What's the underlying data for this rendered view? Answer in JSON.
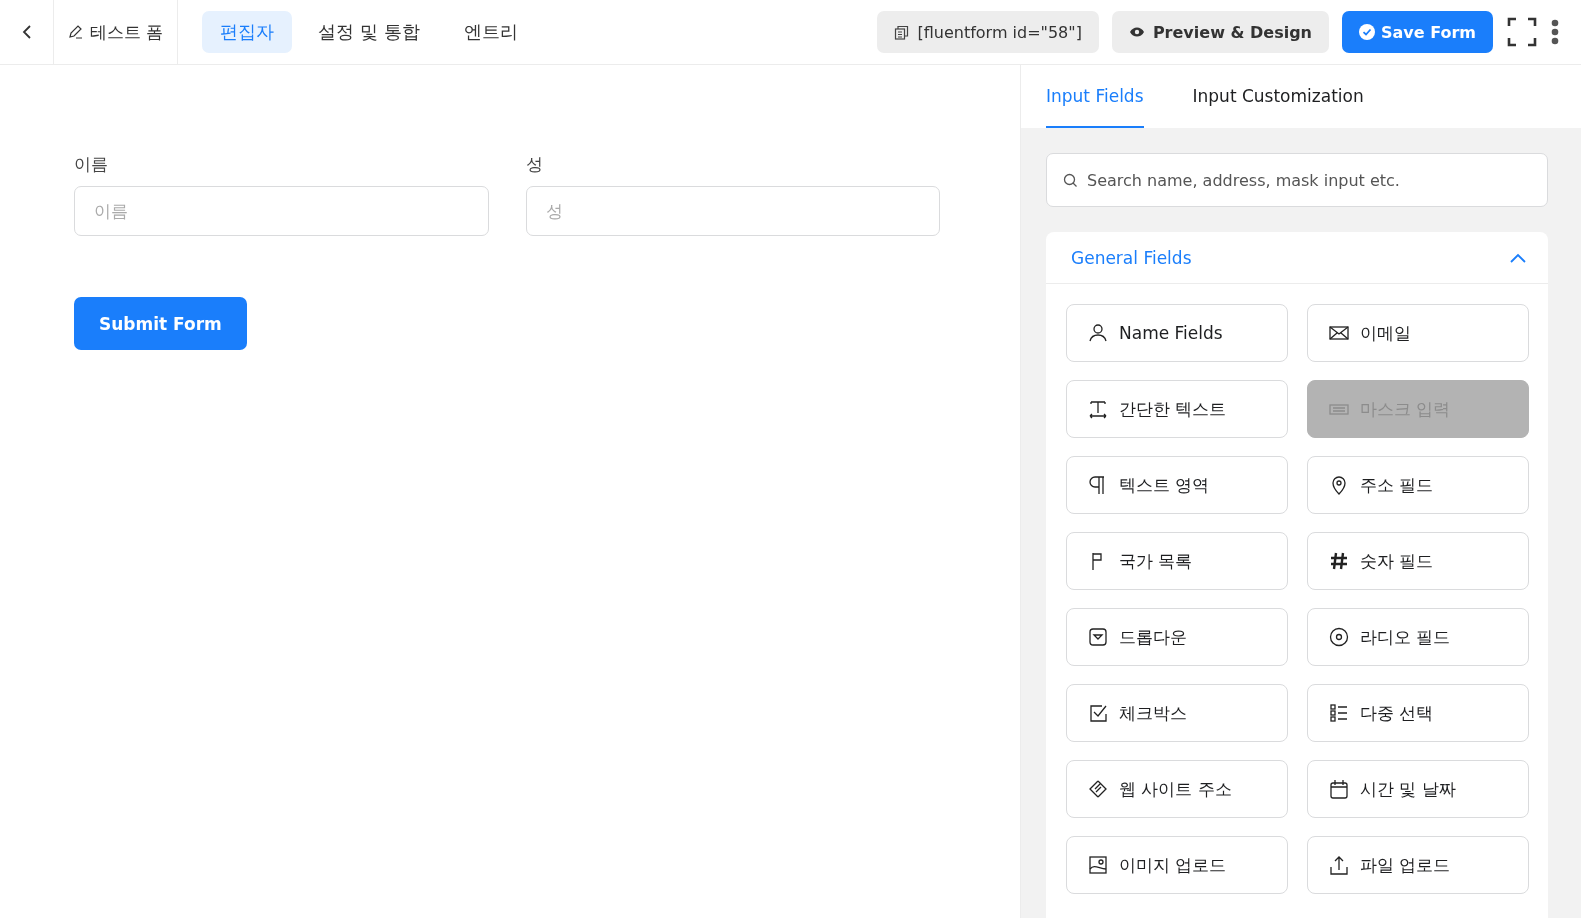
{
  "header": {
    "form_title": "테스트 폼",
    "tabs": [
      {
        "label": "편집자",
        "selected": true
      },
      {
        "label": "설정 및 통합",
        "selected": false
      },
      {
        "label": "엔트리",
        "selected": false
      }
    ],
    "shortcode": "[fluentform id=\"58\"]",
    "preview_button": "Preview & Design",
    "save_button": "Save Form"
  },
  "form": {
    "fields": [
      {
        "label": "이름",
        "placeholder": "이름"
      },
      {
        "label": "성",
        "placeholder": "성"
      }
    ],
    "submit_button": "Submit Form"
  },
  "panel": {
    "tabs": [
      {
        "label": "Input Fields",
        "selected": true
      },
      {
        "label": "Input Customization",
        "selected": false
      }
    ],
    "search": {
      "placeholder": "Search name, address, mask input etc."
    },
    "section": {
      "title": "General Fields",
      "expanded": true,
      "items": [
        {
          "label": "Name Fields",
          "kind": "person",
          "disabled": false
        },
        {
          "label": "이메일",
          "kind": "envelope",
          "disabled": false
        },
        {
          "label": "간단한 텍스트",
          "kind": "text",
          "disabled": false
        },
        {
          "label": "마스크 입력",
          "kind": "keyboard",
          "disabled": true
        },
        {
          "label": "텍스트 영역",
          "kind": "paragraph",
          "disabled": false
        },
        {
          "label": "주소 필드",
          "kind": "pin",
          "disabled": false
        },
        {
          "label": "국가 목록",
          "kind": "flag",
          "disabled": false
        },
        {
          "label": "숫자 필드",
          "kind": "hash",
          "disabled": false
        },
        {
          "label": "드롭다운",
          "kind": "dropdown",
          "disabled": false
        },
        {
          "label": "라디오 필드",
          "kind": "radio",
          "disabled": false
        },
        {
          "label": "체크박스",
          "kind": "checkbox",
          "disabled": false
        },
        {
          "label": "다중 선택",
          "kind": "list",
          "disabled": false
        },
        {
          "label": "웹 사이트 주소",
          "kind": "link",
          "disabled": false
        },
        {
          "label": "시간 및 날짜",
          "kind": "calendar",
          "disabled": false
        },
        {
          "label": "이미지 업로드",
          "kind": "image",
          "disabled": false
        },
        {
          "label": "파일 업로드",
          "kind": "upload",
          "disabled": false
        }
      ]
    }
  }
}
